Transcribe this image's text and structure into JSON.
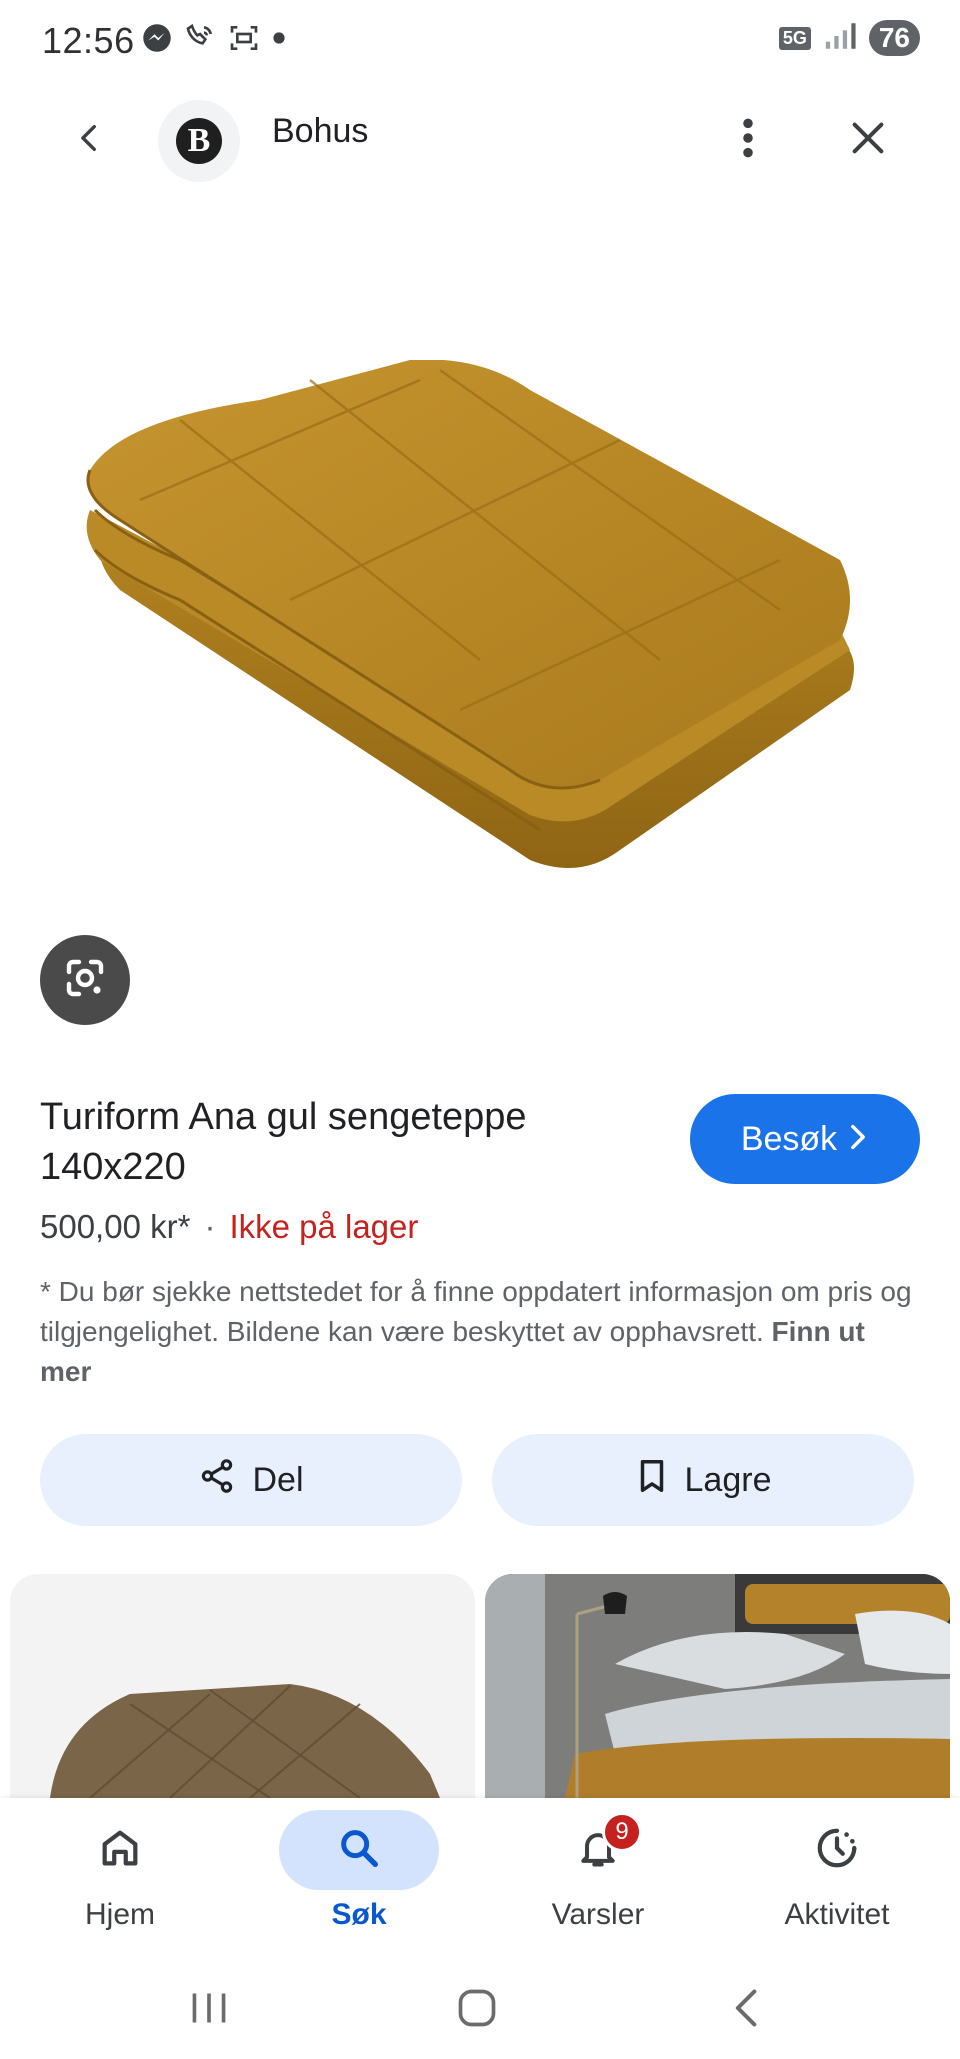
{
  "status_bar": {
    "time": "12:56",
    "network": "5G",
    "battery": "76",
    "icons": [
      "messenger-icon",
      "wifi-call-icon",
      "screenshot-icon",
      "dot-icon",
      "5g-icon",
      "signal-icon",
      "battery-icon"
    ]
  },
  "top_bar": {
    "site_name": "Bohus",
    "logo_letter": "B",
    "icons": [
      "back-arrow-icon",
      "more-vert-icon",
      "close-icon"
    ]
  },
  "product": {
    "title": "Turiform Ana gul sengeteppe 140x220",
    "price": "500,00 kr*",
    "separator": "·",
    "stock_status": "Ikke på lager",
    "visit_label": "Besøk",
    "disclaimer": "* Du bør sjekke nettstedet for å finne oppdatert informasjon om pris og tilgjengelighet. Bildene kan være beskyttet av opphavsrett.",
    "learn_more": "Finn ut mer"
  },
  "actions": {
    "share_label": "Del",
    "save_label": "Lagre"
  },
  "bottom_nav": {
    "items": [
      {
        "label": "Hjem",
        "icon": "home-icon"
      },
      {
        "label": "Søk",
        "icon": "search-icon"
      },
      {
        "label": "Varsler",
        "icon": "bell-icon",
        "badge": "9"
      },
      {
        "label": "Aktivitet",
        "icon": "activity-icon"
      }
    ],
    "active": "Søk"
  },
  "colors": {
    "accent": "#1a73e8",
    "stock_red": "#c5221f",
    "chip_bg": "#e8f0fe",
    "active_nav_bg": "#d3e3fd",
    "product_mustard": "#b8861e"
  }
}
